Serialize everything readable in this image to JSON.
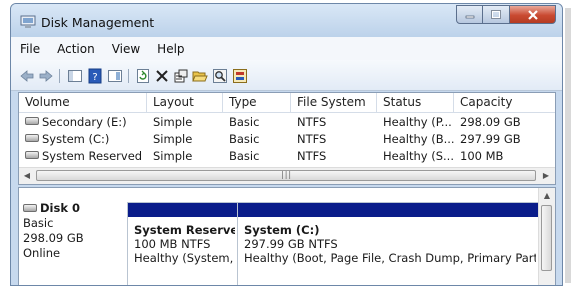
{
  "window": {
    "title": "Disk Management"
  },
  "menu": [
    "File",
    "Action",
    "View",
    "Help"
  ],
  "toolbar": {
    "buttons": [
      "back-icon",
      "forward-icon",
      "show-hide-console-tree-icon",
      "help-icon",
      "properties-view-icon",
      "refresh-icon",
      "delete-icon",
      "properties-icon",
      "open-folder-icon",
      "search-icon",
      "settings-icon"
    ]
  },
  "volume_table": {
    "columns": [
      "Volume",
      "Layout",
      "Type",
      "File System",
      "Status",
      "Capacity"
    ],
    "rows": [
      {
        "volume": "Secondary (E:)",
        "layout": "Simple",
        "type": "Basic",
        "file_system": "NTFS",
        "status": "Healthy (P...",
        "capacity": "298.09 GB"
      },
      {
        "volume": "System (C:)",
        "layout": "Simple",
        "type": "Basic",
        "file_system": "NTFS",
        "status": "Healthy (B...",
        "capacity": "297.99 GB"
      },
      {
        "volume": "System Reserved",
        "layout": "Simple",
        "type": "Basic",
        "file_system": "NTFS",
        "status": "Healthy (S...",
        "capacity": "100 MB"
      }
    ]
  },
  "disk": {
    "name": "Disk 0",
    "type": "Basic",
    "size": "298.09 GB",
    "state": "Online",
    "partitions": [
      {
        "name": "System Reserved",
        "size_fs": "100 MB NTFS",
        "status": "Healthy (System, Active, Primary Partition)"
      },
      {
        "name": "System  (C:)",
        "size_fs": "297.99 GB NTFS",
        "status": "Healthy (Boot, Page File, Crash Dump, Primary Partition)"
      }
    ]
  },
  "colors": {
    "partition_bar": "#0a1c8a",
    "title_gradient": "#c7d9ee",
    "close_button": "#c94a31"
  }
}
